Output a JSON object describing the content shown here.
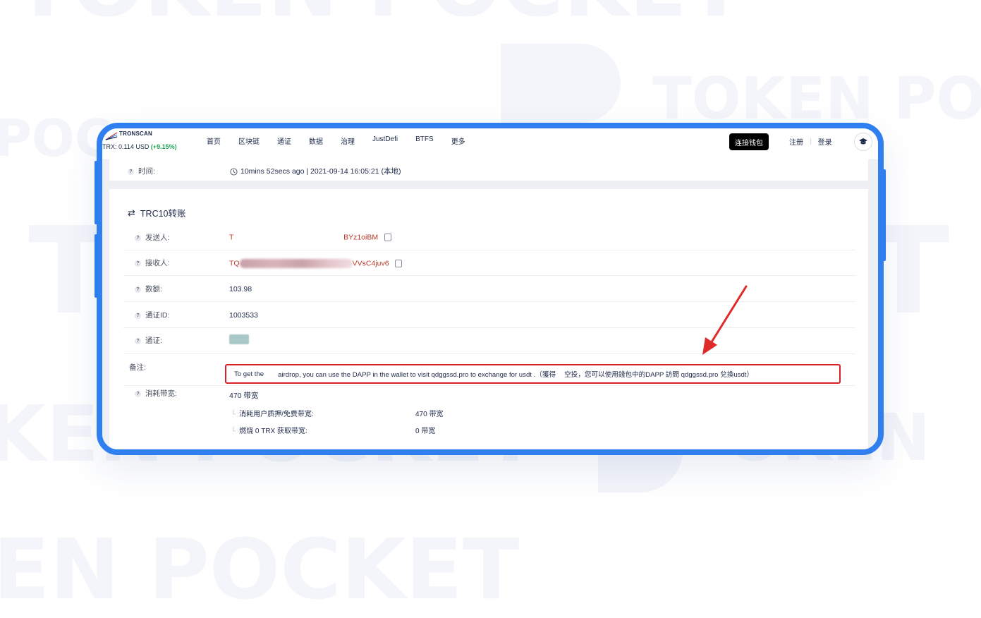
{
  "watermark": {
    "brand_top": "TOKEN POCKET",
    "brand_bottom": "TOKEN POCKET"
  },
  "tronscan": {
    "logo_text": "TRONSCAN",
    "price_prefix": "TRX: 0.114 USD",
    "price_change": "(+9.15%)",
    "nav": [
      "首页",
      "区块链",
      "通证",
      "数据",
      "治理",
      "JustDefi",
      "BTFS",
      "更多"
    ],
    "connect_wallet": "连接钱包",
    "register": "注册",
    "auth_separator": "|",
    "login": "登录",
    "avatar_icon": "mortarboard-icon"
  },
  "time_row": {
    "label": "时间:",
    "value": "10mins 52secs ago | 2021-09-14 16:05:21 (本地)",
    "icon": "clock-icon"
  },
  "section": {
    "title": "TRC10转账",
    "icon": "transfer-arrows-icon"
  },
  "rows": {
    "sender": {
      "label": "发送人:",
      "prefix": "T",
      "suffix": "BYz1oiBM"
    },
    "receiver": {
      "label": "接收人:",
      "prefix": "TQ",
      "suffix": "VVsC4juv6"
    },
    "amount": {
      "label": "数额:",
      "value": "103.98"
    },
    "token_id": {
      "label": "通证ID:",
      "value": "1003533"
    },
    "token": {
      "label": "通证:"
    },
    "memo": {
      "label": "备注:",
      "text_part1": "To get the",
      "text_part2": "airdrop, you can use the DAPP in the wallet to visit qdggssd.pro to exchange for usdt .（獲得",
      "text_part3": "空投，您可以使用錢包中的DAPP 訪問 qdggssd.pro 兌換usdt）"
    },
    "bandwidth": {
      "label": "消耗带宽:",
      "value": "470 带宽",
      "sub1_label": "消耗用户质押/免费带宽:",
      "sub1_value": "470 带宽",
      "sub2_label": "燃烧 0 TRX 获取带宽:",
      "sub2_value": "0 带宽"
    }
  },
  "colors": {
    "frame": "#2f7ff0",
    "highlight_box": "#d8232a",
    "arrow": "#e02a2a",
    "address_text": "#c0392b",
    "price_up": "#20a55a"
  }
}
